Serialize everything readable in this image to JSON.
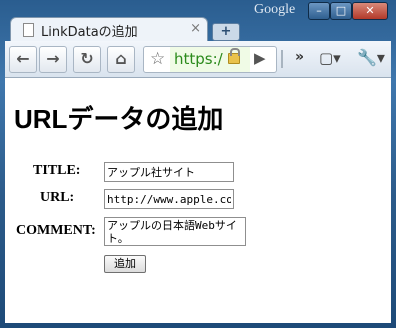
{
  "window": {
    "brand": "Google",
    "minimize": "–",
    "maximize": "□",
    "close": "✕"
  },
  "tab": {
    "title": "LinkDataの追加",
    "close": "×"
  },
  "newtab": "+",
  "toolbar": {
    "back": "←",
    "forward": "→",
    "reload": "↻",
    "home": "⌂",
    "star": "☆",
    "url": "https:/",
    "go": "▶",
    "overflow": "»",
    "page_menu": "▢▾",
    "wrench_menu": "🔧▾"
  },
  "page": {
    "heading": "URLデータの追加",
    "form": {
      "title_label": "TITLE:",
      "title_value": "アップル社サイト",
      "url_label": "URL:",
      "url_value": "http://www.apple.com/jp/",
      "comment_label": "COMMENT:",
      "comment_value": "アップルの日本語Webサイト。",
      "submit_label": "追加"
    }
  }
}
